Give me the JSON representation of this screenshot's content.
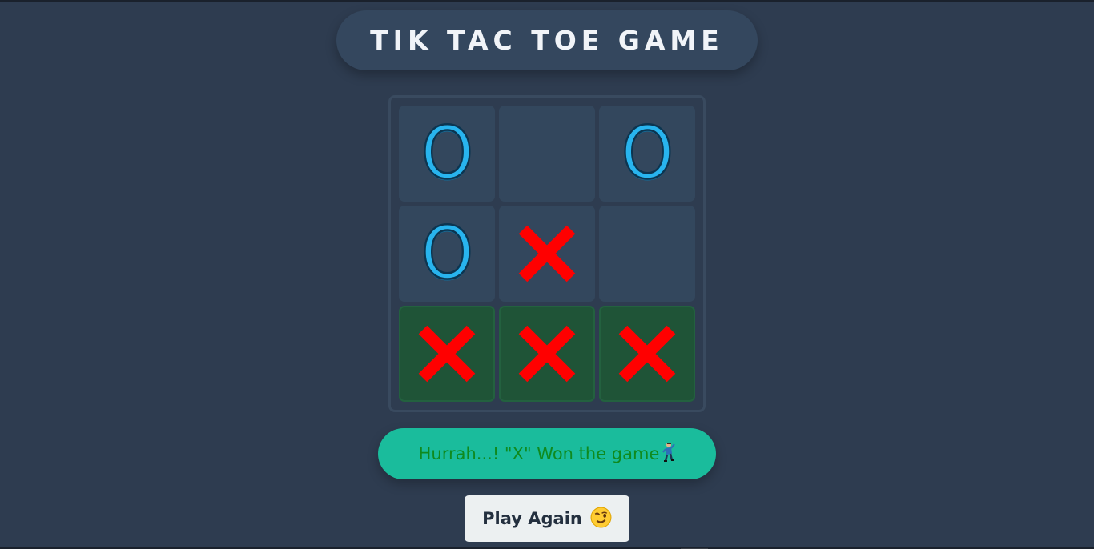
{
  "header": {
    "title": "TIK TAC TOE GAME"
  },
  "board": {
    "cells": [
      "O",
      "",
      "O",
      "O",
      "X",
      "",
      "X",
      "X",
      "X"
    ],
    "winning_cells": [
      6,
      7,
      8
    ]
  },
  "status": {
    "message": "Hurrah...! \"X\" Won the game",
    "icon": "dancing-man-icon"
  },
  "actions": {
    "play_again_label": "Play Again",
    "play_again_icon": "winking-face-icon"
  },
  "colors": {
    "background": "#2e3c50",
    "title_pill": "#34475e",
    "cell": "#33475d",
    "winning_cell": "#1f5437",
    "o_mark": "#28b4ee",
    "x_mark": "#ff0000",
    "status_pill": "#1abc9c",
    "status_text": "#0f8a1e",
    "button": "#ecf0f1"
  }
}
